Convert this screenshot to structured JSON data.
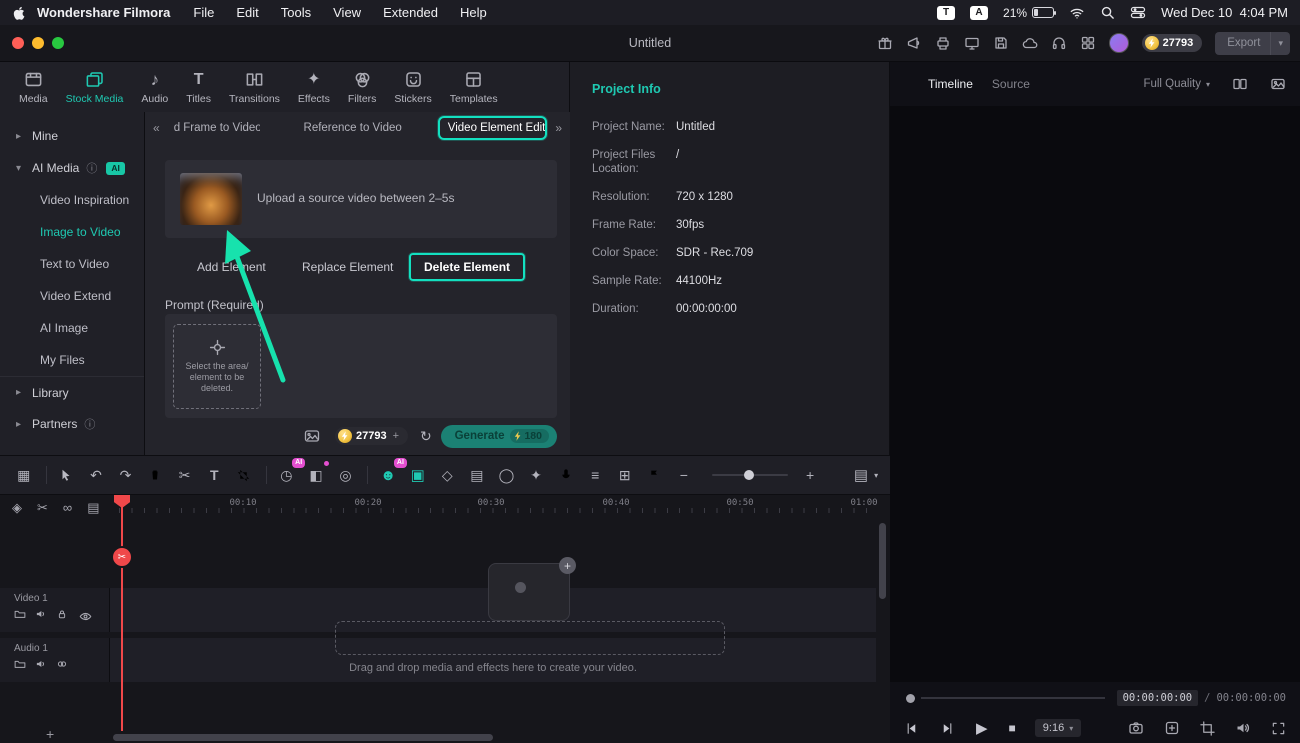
{
  "icons": {
    "caret_right": "▸",
    "caret_down": "▾",
    "info": "ⓘ",
    "chevrons_left": "«",
    "chevrons_right": "»",
    "grid": "▦",
    "undo": "↶",
    "redo": "↷",
    "scissors": "✂",
    "text_tool": "T",
    "speed": "◷",
    "mask": "◧",
    "motion": "◎",
    "person": "☻",
    "reframe": "▣",
    "keyframe": "◇",
    "render_bar": "▤",
    "chroma": "◯",
    "effects_star": "✦",
    "mixer": "≡",
    "pip": "⊞",
    "minus": "−",
    "plus": "+",
    "refresh": "↻",
    "play": "▶",
    "stop": "■",
    "music_note": "♪",
    "kf_diamond": "◈",
    "link_loop": "∞"
  },
  "menubar": {
    "app_name": "Wondershare Filmora",
    "menus": [
      "File",
      "Edit",
      "Tools",
      "View",
      "Extended",
      "Help"
    ],
    "t_badge": "T",
    "input_badge": "A",
    "battery_percent": "21%",
    "clock": "Wed Dec 10  4:04 PM"
  },
  "titlebar": {
    "document_title": "Untitled",
    "coin_balance": "27793",
    "export_label": "Export"
  },
  "ribbon": {
    "tabs": [
      {
        "label": "Media"
      },
      {
        "label": "Stock Media"
      },
      {
        "label": "Audio"
      },
      {
        "label": "Titles"
      },
      {
        "label": "Transitions"
      },
      {
        "label": "Effects"
      },
      {
        "label": "Filters"
      },
      {
        "label": "Stickers"
      },
      {
        "label": "Templates"
      }
    ]
  },
  "sidebar": {
    "ai_badge": "AI",
    "items": [
      {
        "label": "Mine"
      },
      {
        "label": "AI Media"
      },
      {
        "label": "Video Inspiration"
      },
      {
        "label": "Image to Video"
      },
      {
        "label": "Text to Video"
      },
      {
        "label": "Video Extend"
      },
      {
        "label": "AI Image"
      },
      {
        "label": "My Files"
      },
      {
        "label": "Library"
      },
      {
        "label": "Partners"
      }
    ]
  },
  "element_panel": {
    "tabs": [
      {
        "label": "d Frame to Video"
      },
      {
        "label": "Reference to Video"
      },
      {
        "label": "Video Element Editi"
      }
    ],
    "upload_hint": "Upload a source video between 2–5s",
    "add_element": "Add Element",
    "replace_element": "Replace Element",
    "delete_element": "Delete Element",
    "prompt_label": "Prompt (Required)",
    "select_hint": "Select the area/ element to be deleted.",
    "coin_balance": "27793",
    "coin_plus": "+",
    "generate_label": "Generate",
    "generate_cost": "180"
  },
  "project_info": {
    "title": "Project Info",
    "fields": [
      {
        "label": "Project Name:",
        "value": "Untitled"
      },
      {
        "label": "Project Files Location:",
        "value": "/"
      },
      {
        "label": "Resolution:",
        "value": "720 x 1280"
      },
      {
        "label": "Frame Rate:",
        "value": "30fps"
      },
      {
        "label": "Color Space:",
        "value": "SDR - Rec.709"
      },
      {
        "label": "Sample Rate:",
        "value": "44100Hz"
      },
      {
        "label": "Duration:",
        "value": "00:00:00:00"
      }
    ]
  },
  "preview": {
    "tab_timeline": "Timeline",
    "tab_source": "Source",
    "quality": "Full Quality",
    "current_time": "00:00:00:00",
    "separator": "/",
    "total_time": "00:00:00:00",
    "aspect_ratio": "9:16"
  },
  "timeline": {
    "ruler": [
      "00:10",
      "00:20",
      "00:30",
      "00:40",
      "00:50",
      "01:00"
    ],
    "video_track": "Video 1",
    "audio_track": "Audio 1",
    "drop_hint": "Drag and drop media and effects here to create your video."
  },
  "colors": {
    "accent_teal": "#1fc9b2",
    "highlight_teal": "#13e0c0",
    "ai_pink": "#e44fd0",
    "playhead_red": "#f0484a",
    "coin_gold": "#f2c341"
  }
}
